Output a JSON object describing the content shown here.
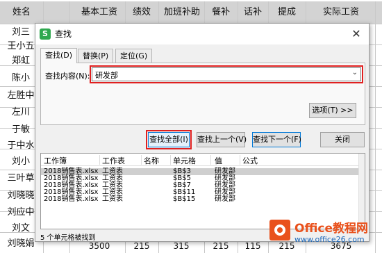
{
  "sheet": {
    "headers": [
      "姓名",
      "基本工资",
      "绩效",
      "加班补助",
      "餐补",
      "话补",
      "提成",
      "实际工资"
    ],
    "names": [
      "刘三",
      "王小五",
      "郑虹",
      "陈小",
      "左胜中",
      "左川",
      "于敏",
      "于中水",
      "刘小",
      "三叶草",
      "刘晓晓",
      "刘应中",
      "刘文",
      "刘晓娟"
    ],
    "last_row": [
      "3500",
      "215",
      "315",
      "215",
      "115",
      "215",
      "3675"
    ]
  },
  "dialog": {
    "title": "查找",
    "close_glyph": "✕",
    "app_icon_letter": "S",
    "tabs": [
      "查找(D)",
      "替换(P)",
      "定位(G)"
    ],
    "active_tab": "查找(D)",
    "find_label": "查找内容(N):",
    "find_value": "研发部",
    "combo_arrow": "⌄",
    "options_button": "选项(T) >>",
    "find_all_button": "查找全部(I)",
    "find_prev_button": "查找上一个(V)",
    "find_next_button": "查找下一个(F)",
    "close_button": "关闭",
    "results_columns": [
      "工作簿",
      "工作表",
      "名称",
      "单元格",
      "值",
      "公式"
    ],
    "results": [
      {
        "workbook": "2018销售表.xlsx",
        "sheet": "工资表",
        "name": "",
        "cell": "$B$3",
        "value": "研发部",
        "formula": ""
      },
      {
        "workbook": "2018销售表.xlsx",
        "sheet": "工资表",
        "name": "",
        "cell": "$B$5",
        "value": "研发部",
        "formula": ""
      },
      {
        "workbook": "2018销售表.xlsx",
        "sheet": "工资表",
        "name": "",
        "cell": "$B$7",
        "value": "研发部",
        "formula": ""
      },
      {
        "workbook": "2018销售表.xlsx",
        "sheet": "工资表",
        "name": "",
        "cell": "$B$11",
        "value": "研发部",
        "formula": ""
      },
      {
        "workbook": "2018销售表.xlsx",
        "sheet": "工资表",
        "name": "",
        "cell": "$B$15",
        "value": "研发部",
        "formula": ""
      }
    ],
    "status": "5 个单元格被找到"
  },
  "watermark": {
    "name": "Office教程网",
    "url": "www.office26.com"
  },
  "colors": {
    "highlight_box": "#e02020",
    "accent_blue": "#0078d7",
    "app_green": "#2fa84f",
    "watermark_orange": "#e9511c"
  }
}
